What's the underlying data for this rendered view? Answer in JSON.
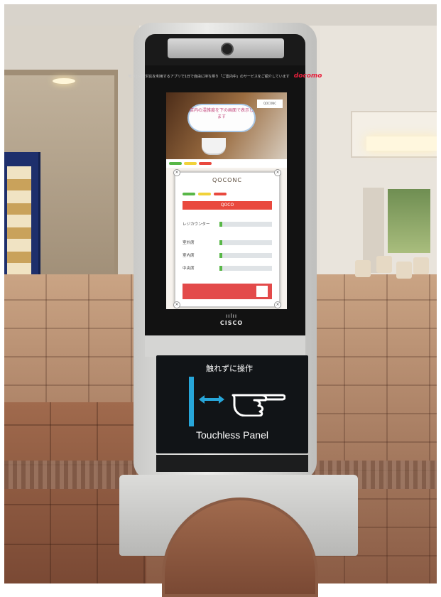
{
  "kiosk": {
    "docomo_small_text": "地下1〜8F対応を利用するアプリで1日で自由に持ち帰り「ご案内中」のサービスをご紹介しています",
    "docomo_brand": "docomo",
    "cisco_bars": "ıılıı",
    "cisco_label": "CISCO",
    "panel_japanese": "触れずに操作",
    "panel_english": "Touchless Panel"
  },
  "display": {
    "banner_text": "店内の混雑度を下の画面で表示します",
    "banner_logo": "QOCONC",
    "popup_logo": "QOCONC",
    "popup_red_label": "QOCO",
    "rows": [
      {
        "label": "レジカウンター",
        "level": 0.05
      },
      {
        "label": "室外席",
        "level": 0.05
      },
      {
        "label": "室内席",
        "level": 0.05
      },
      {
        "label": "中央席",
        "level": 0.05
      }
    ]
  },
  "colors": {
    "accent_blue": "#27a6d9",
    "docomo_red": "#e8203c",
    "status_green": "#58b747",
    "status_yellow": "#f1d23a",
    "status_red": "#e9493e"
  }
}
